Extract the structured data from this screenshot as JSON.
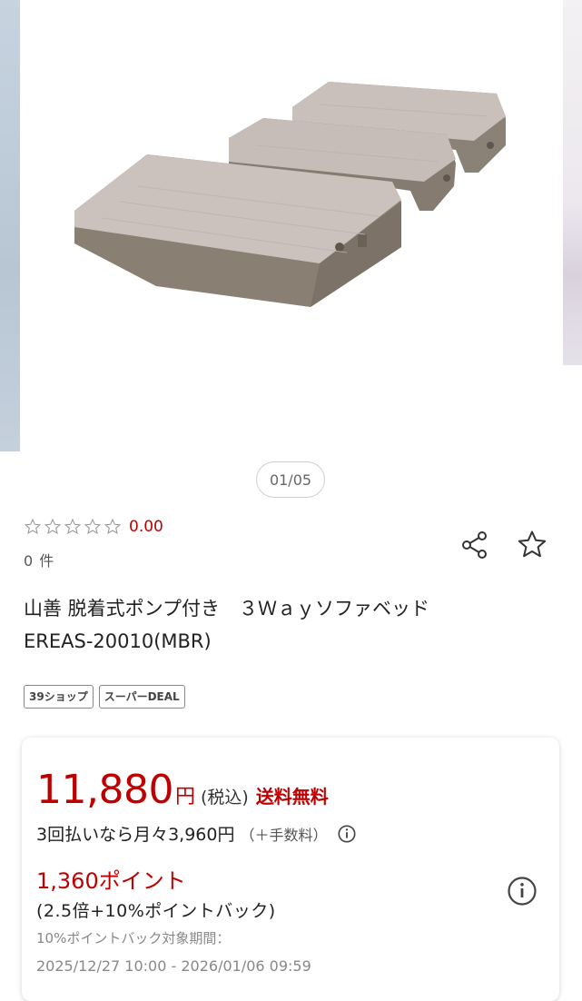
{
  "gallery": {
    "pager": "01/05"
  },
  "rating": {
    "score": "0.00",
    "review_count": "0 件"
  },
  "actions": {
    "share_icon": "share-icon",
    "favorite_icon": "star-outline-icon"
  },
  "product": {
    "title_line1": "山善 脱着式ポンプ付き　３Ｗａｙソファベッド",
    "title_line2": "EREAS-20010(MBR)",
    "badges": [
      "39ショップ",
      "スーパーDEAL"
    ]
  },
  "price_card": {
    "price": "11,880",
    "yen": "円",
    "tax": "(税込)",
    "shipping": "送料無料",
    "installment_text": "3回払いなら月々3,960円",
    "installment_fee": "（＋手数料）",
    "points": "1,360ポイント",
    "points_detail": "(2.5倍+10%ポイントバック)",
    "period_label": "10%ポイントバック対象期間：",
    "period": "2025/12/27 10:00 - 2026/01/06 09:59"
  },
  "colors": {
    "accent": "#bf0000"
  }
}
